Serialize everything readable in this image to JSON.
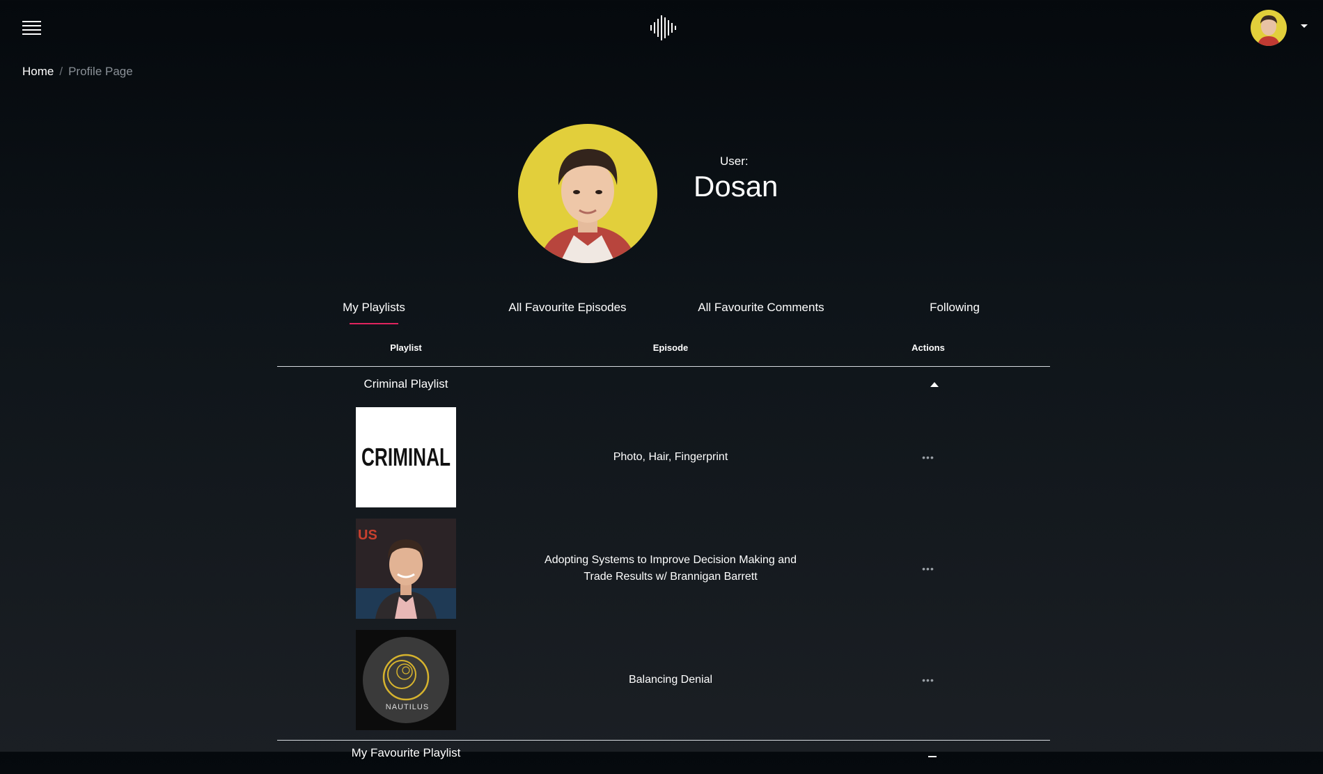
{
  "header": {
    "menu_icon": "hamburger-menu-icon",
    "logo_icon": "soundwave-logo-icon",
    "avatar_caret_icon": "caret-down-icon"
  },
  "breadcrumb": {
    "home": "Home",
    "separator": "/",
    "current": "Profile Page"
  },
  "profile": {
    "user_label": "User:",
    "user_name": "Dosan"
  },
  "tabs": [
    {
      "label": "My Playlists",
      "active": true
    },
    {
      "label": "All Favourite Episodes",
      "active": false
    },
    {
      "label": "All Favourite Comments",
      "active": false
    },
    {
      "label": "Following",
      "active": false
    }
  ],
  "table": {
    "headers": {
      "playlist": "Playlist",
      "episode": "Episode",
      "actions": "Actions"
    },
    "groups": [
      {
        "name": "Criminal Playlist",
        "expanded": true,
        "episodes": [
          {
            "thumb_text": "CRIMINAL",
            "title": "Photo, Hair, Fingerprint",
            "actions": "•••"
          },
          {
            "thumb_text": "US",
            "title": "Adopting Systems to Improve Decision Making and Trade Results w/ Brannigan Barrett",
            "actions": "•••"
          },
          {
            "thumb_text": "NAUTILUS",
            "title": "Balancing Denial",
            "actions": "•••"
          }
        ]
      },
      {
        "name": "My Favourite Playlist",
        "expanded": false
      }
    ]
  },
  "colors": {
    "accent": "#e0245e",
    "background_top": "#05090d",
    "background_bottom": "#1b1f24"
  }
}
